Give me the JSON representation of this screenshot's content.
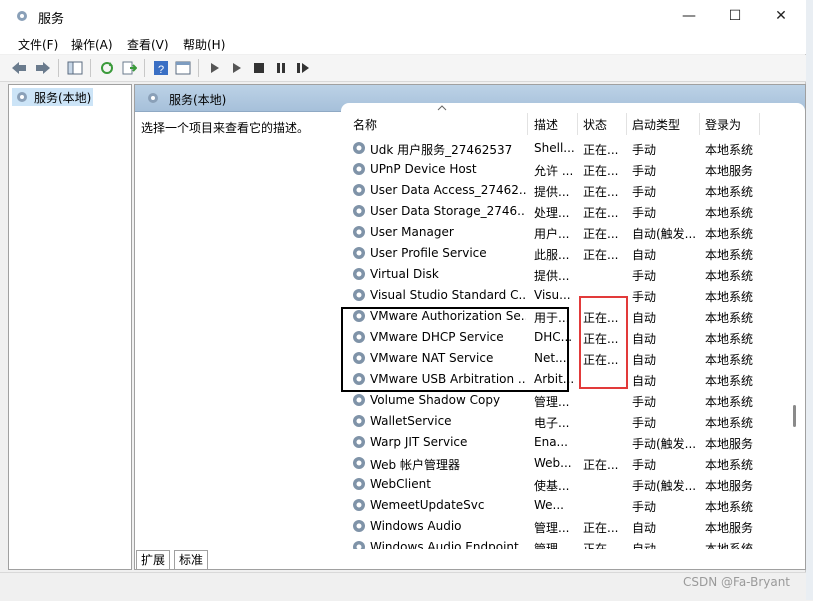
{
  "window": {
    "title": "服务",
    "min": "—",
    "max": "☐",
    "close": "✕"
  },
  "menu": [
    "文件(F)",
    "操作(A)",
    "查看(V)",
    "帮助(H)"
  ],
  "tree": {
    "root": "服务(本地)"
  },
  "panel": {
    "title": "服务(本地)",
    "hint": "选择一个项目来查看它的描述。"
  },
  "columns": {
    "name": "名称",
    "desc": "描述",
    "status": "状态",
    "startup": "启动类型",
    "login": "登录为"
  },
  "services": [
    {
      "name": "Udk 用户服务_27462537",
      "desc": "Shell...",
      "status": "正在...",
      "startup": "手动",
      "login": "本地系统"
    },
    {
      "name": "UPnP Device Host",
      "desc": "允许 ...",
      "status": "正在...",
      "startup": "手动",
      "login": "本地服务"
    },
    {
      "name": "User Data Access_27462...",
      "desc": "提供...",
      "status": "正在...",
      "startup": "手动",
      "login": "本地系统"
    },
    {
      "name": "User Data Storage_2746...",
      "desc": "处理...",
      "status": "正在...",
      "startup": "手动",
      "login": "本地系统"
    },
    {
      "name": "User Manager",
      "desc": "用户...",
      "status": "正在...",
      "startup": "自动(触发...",
      "login": "本地系统"
    },
    {
      "name": "User Profile Service",
      "desc": "此服...",
      "status": "正在...",
      "startup": "自动",
      "login": "本地系统"
    },
    {
      "name": "Virtual Disk",
      "desc": "提供...",
      "status": "",
      "startup": "手动",
      "login": "本地系统"
    },
    {
      "name": "Visual Studio Standard C...",
      "desc": "Visu...",
      "status": "",
      "startup": "手动",
      "login": "本地系统"
    },
    {
      "name": "VMware Authorization Se...",
      "desc": "用于...",
      "status": "正在...",
      "startup": "自动",
      "login": "本地系统"
    },
    {
      "name": "VMware DHCP Service",
      "desc": "DHC...",
      "status": "正在...",
      "startup": "自动",
      "login": "本地系统"
    },
    {
      "name": "VMware NAT Service",
      "desc": "Net...",
      "status": "正在...",
      "startup": "自动",
      "login": "本地系统"
    },
    {
      "name": "VMware USB Arbitration ...",
      "desc": "Arbit...",
      "status": "",
      "startup": "自动",
      "login": "本地系统"
    },
    {
      "name": "Volume Shadow Copy",
      "desc": "管理...",
      "status": "",
      "startup": "手动",
      "login": "本地系统"
    },
    {
      "name": "WalletService",
      "desc": "电子...",
      "status": "",
      "startup": "手动",
      "login": "本地系统"
    },
    {
      "name": "Warp JIT Service",
      "desc": "Ena...",
      "status": "",
      "startup": "手动(触发...",
      "login": "本地服务"
    },
    {
      "name": "Web 帐户管理器",
      "desc": "Web...",
      "status": "正在...",
      "startup": "手动",
      "login": "本地系统"
    },
    {
      "name": "WebClient",
      "desc": "使基...",
      "status": "",
      "startup": "手动(触发...",
      "login": "本地服务"
    },
    {
      "name": "WemeetUpdateSvc",
      "desc": "We...",
      "status": "",
      "startup": "手动",
      "login": "本地系统"
    },
    {
      "name": "Windows Audio",
      "desc": "管理...",
      "status": "正在...",
      "startup": "自动",
      "login": "本地服务"
    },
    {
      "name": "Windows Audio Endpoint...",
      "desc": "管理...",
      "status": "正在...",
      "startup": "自动",
      "login": "本地系统"
    }
  ],
  "tabs": [
    "扩展",
    "标准"
  ],
  "watermark": "CSDN @Fa-Bryant",
  "colors": {
    "header_gradient": "#a6c0da",
    "selection": "#cce4f7",
    "highlight_red": "#e23a3a"
  }
}
